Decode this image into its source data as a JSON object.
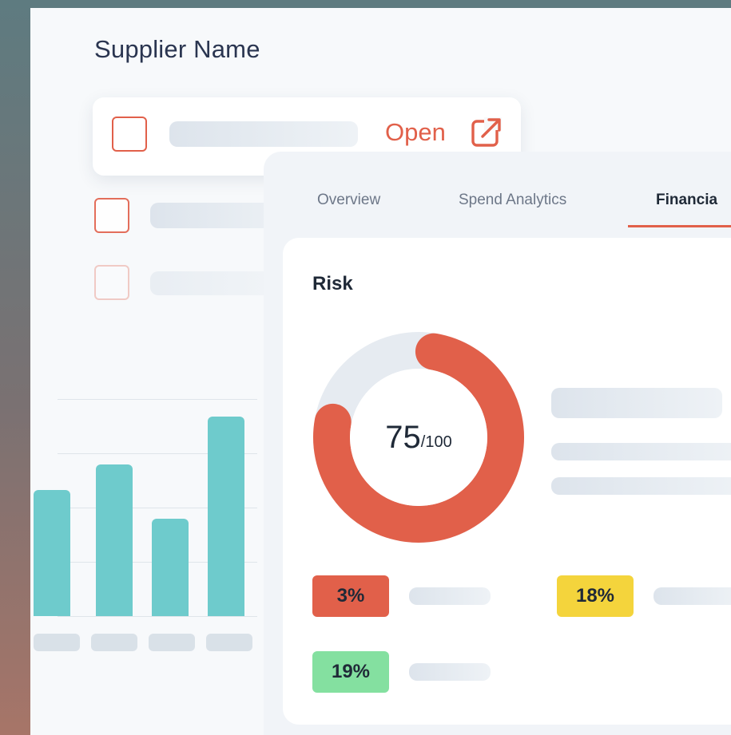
{
  "header": {
    "title": "Supplier Name"
  },
  "row": {
    "open_label": "Open"
  },
  "tabs": [
    {
      "label": "Overview"
    },
    {
      "label": "Spend Analytics"
    },
    {
      "label": "Financia"
    }
  ],
  "risk": {
    "title": "Risk",
    "score": "75",
    "max": "/100",
    "score_fraction": 0.75,
    "badges": [
      {
        "label": "3%",
        "color": "#e1604a"
      },
      {
        "label": "18%",
        "color": "#f4d43c"
      },
      {
        "label": "19%",
        "color": "#84e0a0"
      }
    ]
  },
  "colors": {
    "accent": "#e1604a",
    "bar": "#6ecbcc",
    "donut_track": "#e6ebf1"
  },
  "bars": {
    "values": [
      0.58,
      0.7,
      0.45,
      0.92
    ]
  },
  "icons": {
    "open": "external-link-icon"
  }
}
